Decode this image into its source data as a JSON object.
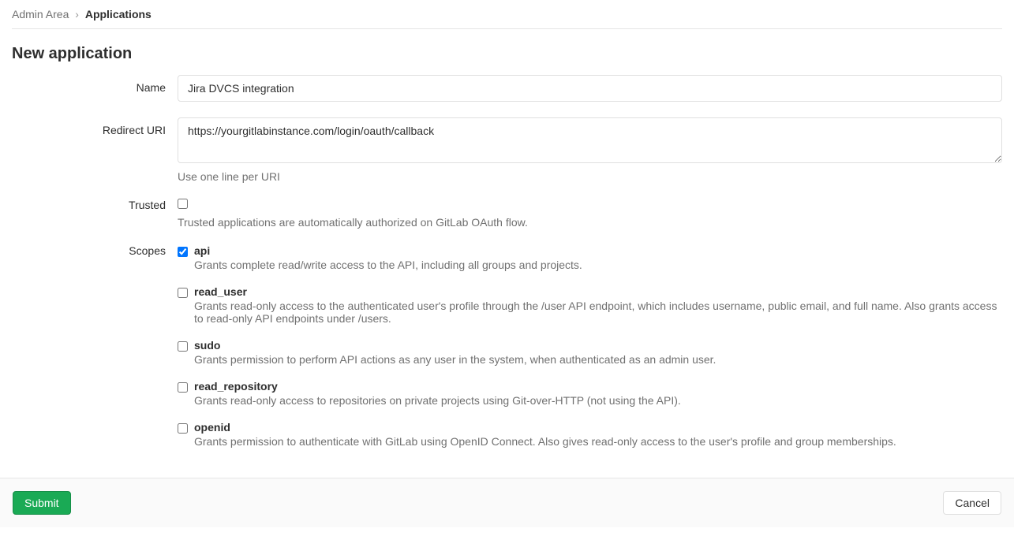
{
  "breadcrumb": {
    "parent": "Admin Area",
    "current": "Applications"
  },
  "page_title": "New application",
  "form": {
    "name": {
      "label": "Name",
      "value": "Jira DVCS integration"
    },
    "redirect_uri": {
      "label": "Redirect URI",
      "value": "https://yourgitlabinstance.com/login/oauth/callback",
      "help": "Use one line per URI"
    },
    "trusted": {
      "label": "Trusted",
      "help": "Trusted applications are automatically authorized on GitLab OAuth flow.",
      "checked": false
    },
    "scopes": {
      "label": "Scopes",
      "items": [
        {
          "name": "api",
          "checked": true,
          "desc": "Grants complete read/write access to the API, including all groups and projects."
        },
        {
          "name": "read_user",
          "checked": false,
          "desc": "Grants read-only access to the authenticated user's profile through the /user API endpoint, which includes username, public email, and full name. Also grants access to read-only API endpoints under /users."
        },
        {
          "name": "sudo",
          "checked": false,
          "desc": "Grants permission to perform API actions as any user in the system, when authenticated as an admin user."
        },
        {
          "name": "read_repository",
          "checked": false,
          "desc": "Grants read-only access to repositories on private projects using Git-over-HTTP (not using the API)."
        },
        {
          "name": "openid",
          "checked": false,
          "desc": "Grants permission to authenticate with GitLab using OpenID Connect. Also gives read-only access to the user's profile and group memberships."
        }
      ]
    }
  },
  "actions": {
    "submit": "Submit",
    "cancel": "Cancel"
  }
}
